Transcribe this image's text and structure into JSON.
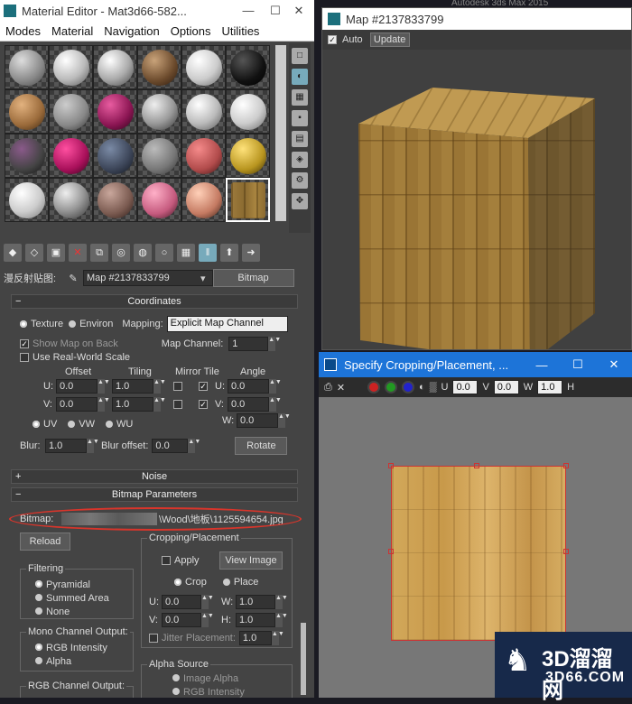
{
  "material_editor": {
    "title": "Material Editor - Mat3d66-582...",
    "menu": [
      "Modes",
      "Material",
      "Navigation",
      "Options",
      "Utilities"
    ],
    "map_label": "漫反射贴图:",
    "map_name": "Map #2137833799",
    "map_type": "Bitmap",
    "coordinates": {
      "header": "Coordinates",
      "texture": "Texture",
      "environ": "Environ",
      "mapping_label": "Mapping:",
      "mapping_value": "Explicit Map Channel",
      "show_map": "Show Map on Back",
      "map_channel_label": "Map Channel:",
      "map_channel": "1",
      "real_world": "Use Real-World Scale",
      "offset": "Offset",
      "tiling": "Tiling",
      "mirror_tile": "Mirror Tile",
      "angle": "Angle",
      "u": "U:",
      "v": "V:",
      "w": "W:",
      "u_offset": "0.0",
      "v_offset": "0.0",
      "u_tiling": "1.0",
      "v_tiling": "1.0",
      "u_angle": "0.0",
      "v_angle": "0.0",
      "w_angle": "0.0",
      "uv": "UV",
      "vw": "VW",
      "wu": "WU",
      "blur_label": "Blur:",
      "blur": "1.0",
      "blur_offset_label": "Blur offset:",
      "blur_offset": "0.0",
      "rotate": "Rotate"
    },
    "noise": "Noise",
    "bitmap_params": "Bitmap Parameters",
    "bitmap_label": "Bitmap:",
    "bitmap_path": "\\Wood\\地板\\1125594654.jpg",
    "reload": "Reload",
    "cropping": {
      "header": "Cropping/Placement",
      "apply": "Apply",
      "view_image": "View Image",
      "crop": "Crop",
      "place": "Place",
      "u": "U:",
      "v": "V:",
      "w": "W:",
      "h": "H:",
      "u_val": "0.0",
      "v_val": "0.0",
      "w_val": "1.0",
      "h_val": "1.0",
      "jitter": "Jitter Placement:",
      "jitter_val": "1.0"
    },
    "filtering": {
      "header": "Filtering",
      "options": [
        "Pyramidal",
        "Summed Area",
        "None"
      ]
    },
    "mono": {
      "header": "Mono Channel Output:",
      "options": [
        "RGB Intensity",
        "Alpha"
      ]
    },
    "rgb_output": "RGB Channel Output:",
    "alpha_source": {
      "header": "Alpha Source",
      "options": [
        "Image Alpha",
        "RGB Intensity"
      ]
    }
  },
  "map_window": {
    "title": "Map #2137833799",
    "auto": "Auto",
    "update": "Update",
    "behind": "Autodesk 3ds Max  2015"
  },
  "crop_window": {
    "title": "Specify Cropping/Placement, ...",
    "u": "U",
    "u_val": "0.0",
    "v": "V",
    "v_val": "0.0",
    "w": "W",
    "w_val": "1.0",
    "h": "H"
  },
  "watermark": {
    "brand": "3D溜溜网",
    "site": "3D66.COM"
  },
  "colors": {
    "accent": "#1d74d8",
    "highlight_oval": "#d9352b"
  }
}
